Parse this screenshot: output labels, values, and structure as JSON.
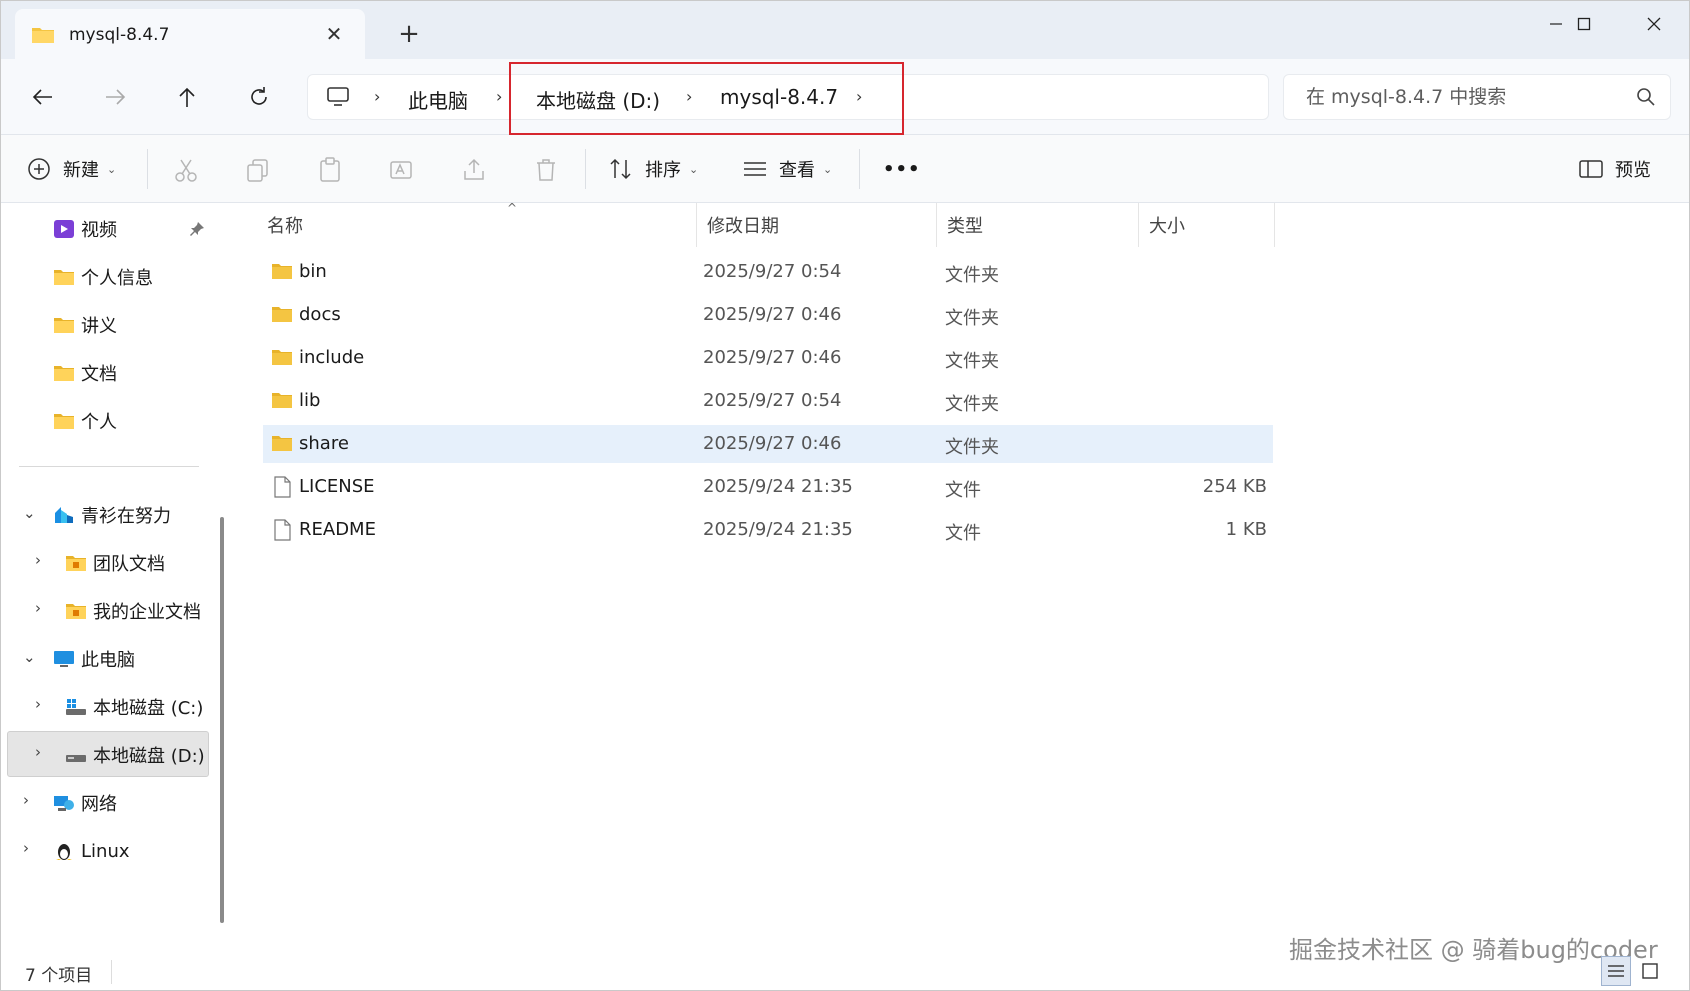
{
  "tab": {
    "title": "mysql-8.4.7",
    "close_glyph": "✕",
    "new_tab_glyph": "+"
  },
  "window_controls": {
    "minimize": "—",
    "maximize": "☐",
    "close": "✕"
  },
  "nav": {
    "back": "←",
    "forward": "→",
    "up": "↑",
    "refresh": "⟳"
  },
  "breadcrumb": {
    "items": [
      "此电脑",
      "本地磁盘 (D:)",
      "mysql-8.4.7"
    ],
    "sep": "›"
  },
  "search": {
    "placeholder": "在 mysql-8.4.7 中搜索"
  },
  "toolbar": {
    "new_label": "新建",
    "sort_label": "排序",
    "view_label": "查看",
    "more_label": "•••",
    "preview_label": "预览",
    "chev": "⌄"
  },
  "sidebar": {
    "quick": [
      {
        "label": "视频",
        "icon": "video-icon",
        "pinned": true
      },
      {
        "label": "个人信息",
        "icon": "folder-icon"
      },
      {
        "label": "讲义",
        "icon": "folder-icon"
      },
      {
        "label": "文档",
        "icon": "folder-icon"
      },
      {
        "label": "个人",
        "icon": "folder-icon"
      }
    ],
    "cloud": {
      "label": "青衫在努力",
      "icon": "cloud-drive-icon"
    },
    "cloud_children": [
      {
        "label": "团队文档",
        "icon": "team-folder-icon"
      },
      {
        "label": "我的企业文档",
        "icon": "enterprise-folder-icon"
      }
    ],
    "pc": {
      "label": "此电脑",
      "icon": "computer-icon"
    },
    "pc_children": [
      {
        "label": "本地磁盘 (C:)",
        "icon": "windows-drive-icon"
      },
      {
        "label": "本地磁盘 (D:)",
        "icon": "drive-icon"
      }
    ],
    "network": {
      "label": "网络",
      "icon": "network-icon"
    },
    "linux": {
      "label": "Linux",
      "icon": "linux-penguin-icon"
    },
    "chev_right": "›",
    "chev_down": "⌄"
  },
  "columns": {
    "name": "名称",
    "modified": "修改日期",
    "type": "类型",
    "size": "大小",
    "sort_glyph": "^"
  },
  "files": [
    {
      "name": "bin",
      "modified": "2025/9/27 0:54",
      "type": "文件夹",
      "size": "",
      "kind": "folder"
    },
    {
      "name": "docs",
      "modified": "2025/9/27 0:46",
      "type": "文件夹",
      "size": "",
      "kind": "folder"
    },
    {
      "name": "include",
      "modified": "2025/9/27 0:46",
      "type": "文件夹",
      "size": "",
      "kind": "folder"
    },
    {
      "name": "lib",
      "modified": "2025/9/27 0:54",
      "type": "文件夹",
      "size": "",
      "kind": "folder"
    },
    {
      "name": "share",
      "modified": "2025/9/27 0:46",
      "type": "文件夹",
      "size": "",
      "kind": "folder",
      "selected": true
    },
    {
      "name": "LICENSE",
      "modified": "2025/9/24 21:35",
      "type": "文件",
      "size": "254 KB",
      "kind": "file"
    },
    {
      "name": "README",
      "modified": "2025/9/24 21:35",
      "type": "文件",
      "size": "1 KB",
      "kind": "file"
    }
  ],
  "status": {
    "count": "7 个项目"
  },
  "watermark": "掘金技术社区 @ 骑着bug的coder",
  "colors": {
    "folder": "#f4c542",
    "accent": "#0067c0",
    "highlight": "#d6262e",
    "selected_row": "#e6f0fb"
  }
}
